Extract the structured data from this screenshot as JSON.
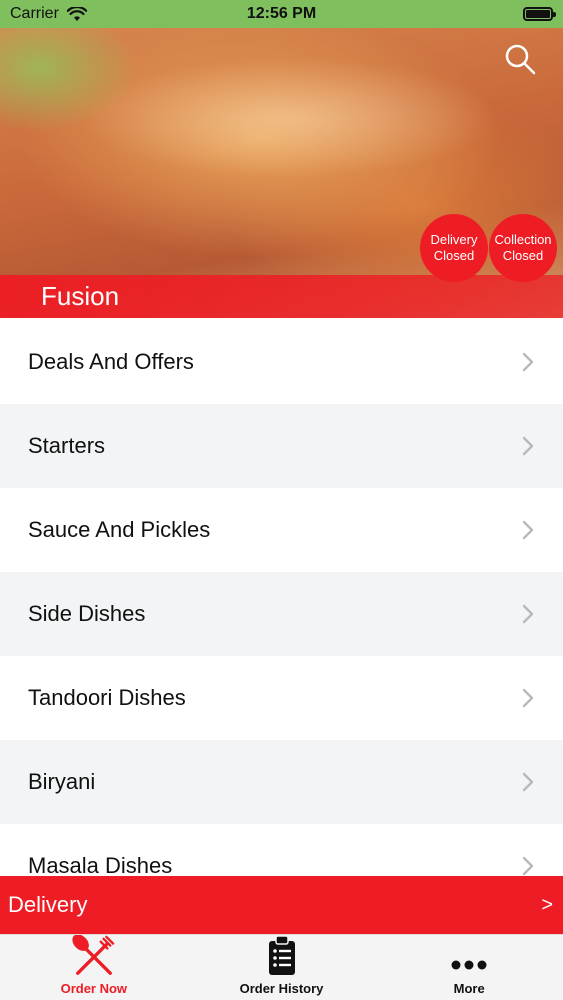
{
  "status_bar": {
    "carrier": "Carrier",
    "time": "12:56 PM"
  },
  "hero": {
    "brand_name": "Fusion",
    "delivery_status": {
      "line1": "Delivery",
      "line2": "Closed"
    },
    "collection_status": {
      "line1": "Collection",
      "line2": "Closed"
    }
  },
  "menu": {
    "items": [
      {
        "label": "Deals And Offers"
      },
      {
        "label": "Starters"
      },
      {
        "label": "Sauce And Pickles"
      },
      {
        "label": "Side Dishes"
      },
      {
        "label": "Tandoori Dishes"
      },
      {
        "label": "Biryani"
      },
      {
        "label": "Masala Dishes"
      }
    ]
  },
  "delivery_bar": {
    "label": "Delivery",
    "arrow": ">"
  },
  "tabs": [
    {
      "label": "Order Now",
      "icon": "fork-knife-icon",
      "active": true
    },
    {
      "label": "Order History",
      "icon": "clipboard-list-icon",
      "active": false
    },
    {
      "label": "More",
      "icon": "more-dots-icon",
      "active": false
    }
  ],
  "colors": {
    "accent": "#ee1c24",
    "status_bar": "#7fbf5e",
    "row_alt": "#f2f4f5"
  }
}
